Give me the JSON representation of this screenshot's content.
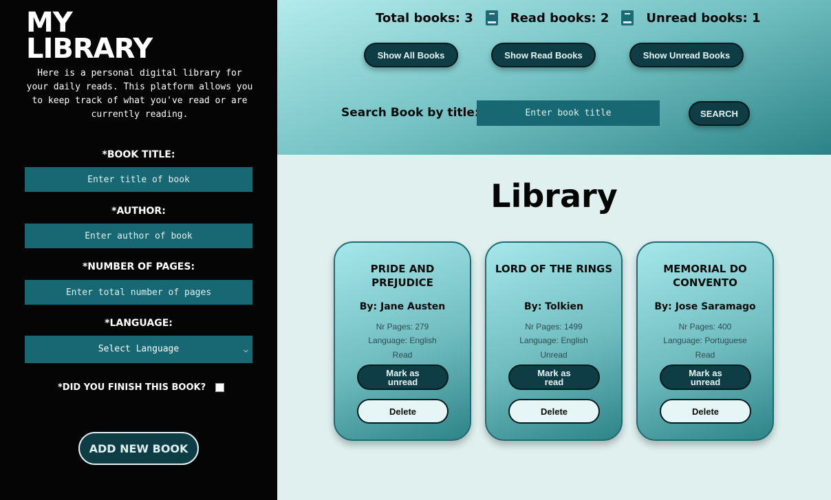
{
  "sidebar": {
    "brand_line1": "MY",
    "brand_line2": "LIBRARY",
    "intro": "Here is a personal digital library for your daily reads. This platform allows you to keep track of what you've read or are currently reading.",
    "form": {
      "title_label": "*BOOK TITLE:",
      "title_placeholder": "Enter title of book",
      "author_label": "*AUTHOR:",
      "author_placeholder": "Enter author of book",
      "pages_label": "*NUMBER OF PAGES:",
      "pages_placeholder": "Enter total number of pages",
      "language_label": "*LANGUAGE:",
      "language_selected": "Select Language",
      "finished_label": "*DID YOU FINISH THIS BOOK?",
      "finished_checked": false,
      "submit_label": "ADD NEW BOOK"
    }
  },
  "stats": {
    "total": "Total books: 3",
    "read": "Read books: 2",
    "unread": "Unread books: 1",
    "icon": "book-icon"
  },
  "filters": {
    "all": "Show All Books",
    "read": "Show Read Books",
    "unread": "Show Unread Books"
  },
  "search": {
    "label": "Search Book by title:",
    "placeholder": "Enter book title",
    "button": "SEARCH"
  },
  "library": {
    "title": "Library",
    "books": [
      {
        "title": "PRIDE AND PREJUDICE",
        "author": "By: Jane Austen",
        "pages": "Nr Pages: 279",
        "language": "Language: English",
        "status": "Read",
        "toggle_label": "Mark as unread",
        "delete_label": "Delete"
      },
      {
        "title": "LORD OF THE RINGS",
        "author": "By: Tolkien",
        "pages": "Nr Pages: 1499",
        "language": "Language: English",
        "status": "Unread",
        "toggle_label": "Mark as read",
        "delete_label": "Delete"
      },
      {
        "title": "MEMORIAL DO CONVENTO",
        "author": "By: Jose Saramago",
        "pages": "Nr Pages: 400",
        "language": "Language: Portuguese",
        "status": "Read",
        "toggle_label": "Mark as unread",
        "delete_label": "Delete"
      }
    ]
  },
  "colors": {
    "sidebar_bg": "#050505",
    "input_bg": "#186873",
    "button_dark": "#0f3d46",
    "page_bg": "#dff0ef"
  }
}
